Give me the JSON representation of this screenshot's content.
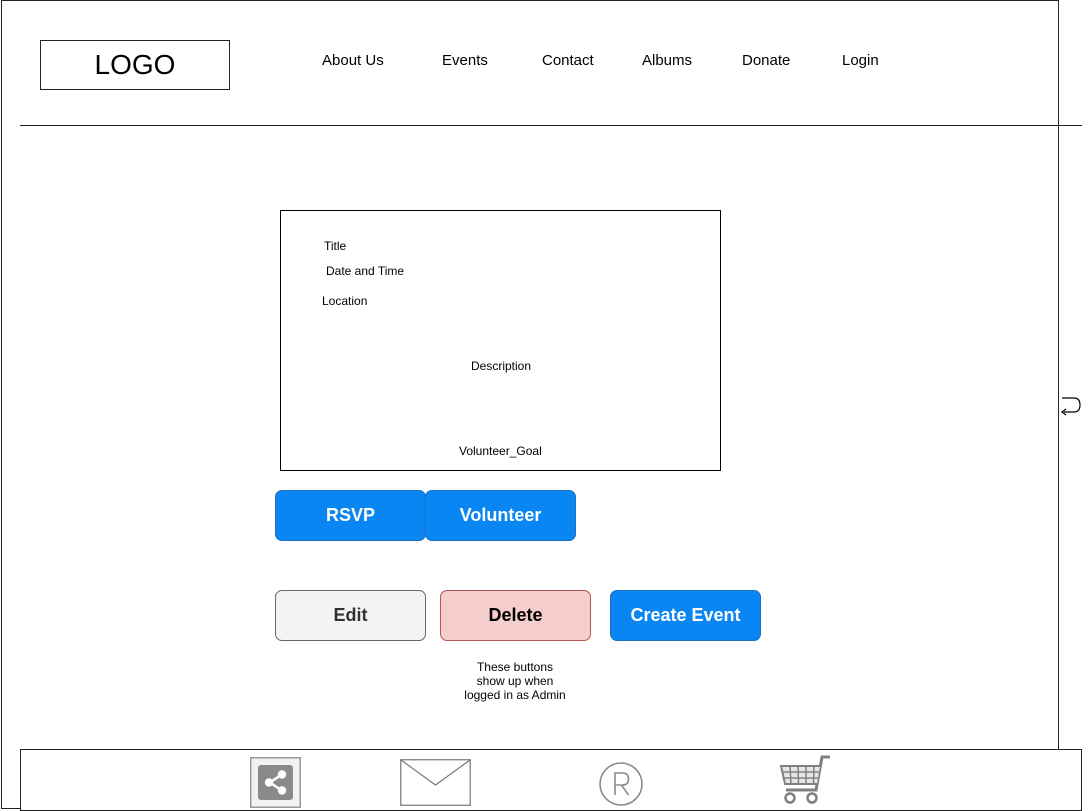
{
  "header": {
    "logo_text": "LOGO",
    "nav": [
      "About Us",
      "Events",
      "Contact",
      "Albums",
      "Donate",
      "Login"
    ]
  },
  "event_card": {
    "title": "Title",
    "date_time": "Date and Time",
    "location": "Location",
    "description": "Description",
    "volunteer_goal": "Volunteer_Goal"
  },
  "actions": {
    "rsvp": "RSVP",
    "volunteer": "Volunteer"
  },
  "admin": {
    "edit": "Edit",
    "delete": "Delete",
    "create_event": "Create Event",
    "note_lines": [
      "These buttons",
      "show up when",
      "logged in as Admin"
    ]
  },
  "footer": {
    "icons": [
      "share-icon",
      "mail-icon",
      "registered-icon",
      "cart-icon"
    ]
  },
  "colors": {
    "primary_button": "#0a85f4",
    "edit_button": "#f4f4f4",
    "delete_button": "#f5cdcc",
    "delete_border": "#b85450"
  }
}
